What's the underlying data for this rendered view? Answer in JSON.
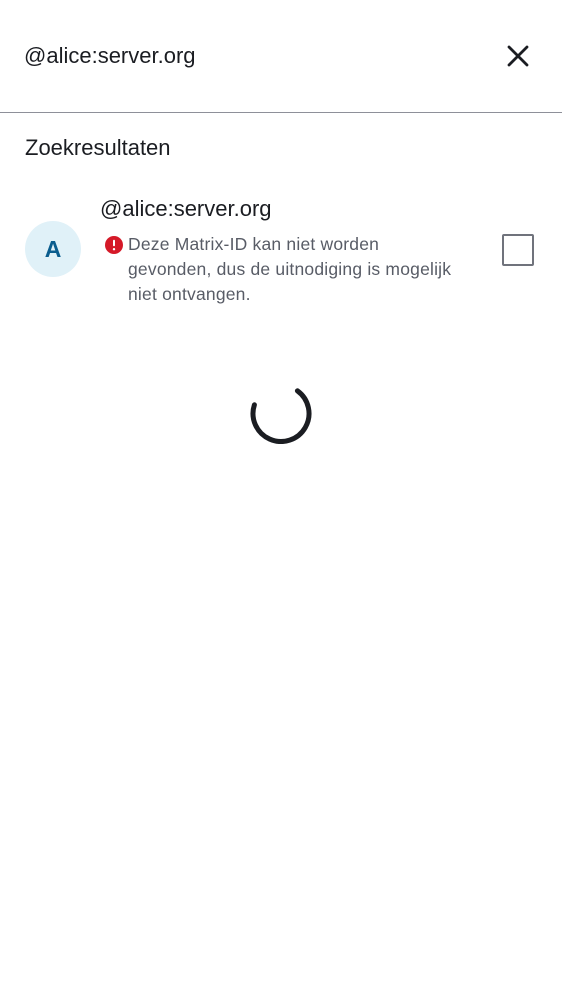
{
  "search": {
    "value": "@alice:server.org"
  },
  "results": {
    "title": "Zoekresultaten",
    "items": [
      {
        "avatar_letter": "A",
        "user_id": "@alice:server.org",
        "error_message": "Deze Matrix-ID kan niet worden gevonden, dus de uitnodiging is mogelijk niet ontvangen.",
        "selected": false
      }
    ]
  },
  "icons": {
    "close": "close-icon",
    "error": "error-icon",
    "spinner": "loading-spinner-icon"
  },
  "colors": {
    "avatar_bg": "#e0f1f8",
    "avatar_text": "#0a5d8e",
    "error": "#d51928",
    "secondary_text": "#585c66"
  }
}
